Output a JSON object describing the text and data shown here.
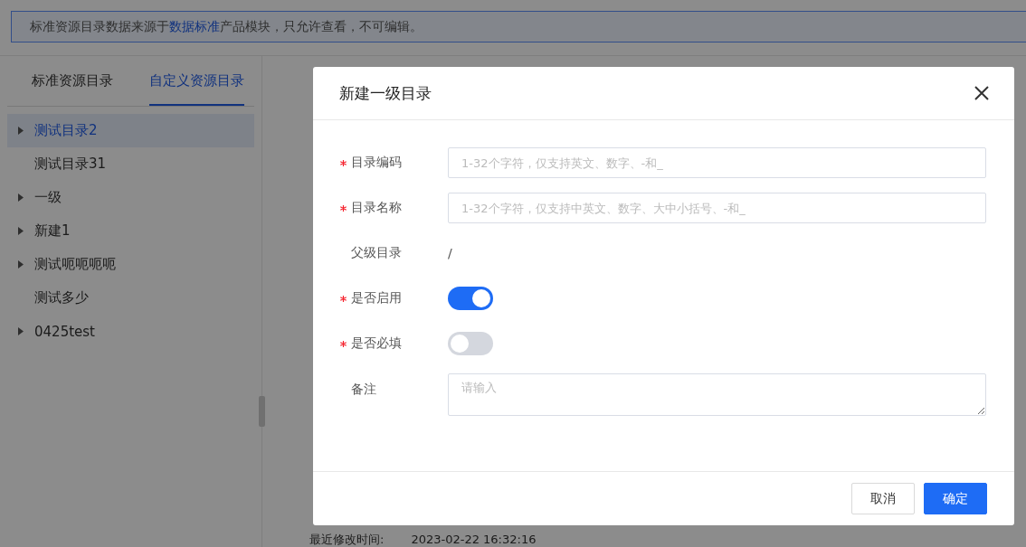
{
  "alert": {
    "before": "标准资源目录数据来源于",
    "link": "数据标准",
    "after": "产品模块，只允许查看，不可编辑。"
  },
  "tabs": [
    {
      "label": "标准资源目录",
      "selected": false
    },
    {
      "label": "自定义资源目录",
      "selected": true
    }
  ],
  "tree": [
    {
      "label": "测试目录2",
      "expandable": true,
      "selected": true
    },
    {
      "label": "测试目录31",
      "expandable": false,
      "selected": false
    },
    {
      "label": "一级",
      "expandable": true,
      "selected": false
    },
    {
      "label": "新建1",
      "expandable": true,
      "selected": false
    },
    {
      "label": "测试呃呃呃呃",
      "expandable": true,
      "selected": false
    },
    {
      "label": "测试多少",
      "expandable": false,
      "selected": false
    },
    {
      "label": "0425test",
      "expandable": true,
      "selected": false
    }
  ],
  "detail": {
    "label": "最近修改时间:",
    "value": "2023-02-22 16:32:16"
  },
  "dialog": {
    "title": "新建一级目录",
    "fields": [
      {
        "kind": "input",
        "label": "目录编码",
        "required": true,
        "placeholder": "1-32个字符，仅支持英文、数字、-和_"
      },
      {
        "kind": "input",
        "label": "目录名称",
        "required": true,
        "placeholder": "1-32个字符，仅支持中英文、数字、大中小括号、-和_"
      },
      {
        "kind": "static",
        "label": "父级目录",
        "required": false,
        "value": "/"
      },
      {
        "kind": "switch",
        "label": "是否启用",
        "required": true,
        "on": true
      },
      {
        "kind": "switch",
        "label": "是否必填",
        "required": true,
        "on": false
      },
      {
        "kind": "textarea",
        "label": "备注",
        "required": false,
        "placeholder": "请输入"
      }
    ],
    "buttons": [
      {
        "label": "取消",
        "primary": false
      },
      {
        "label": "确定",
        "primary": true
      }
    ]
  }
}
